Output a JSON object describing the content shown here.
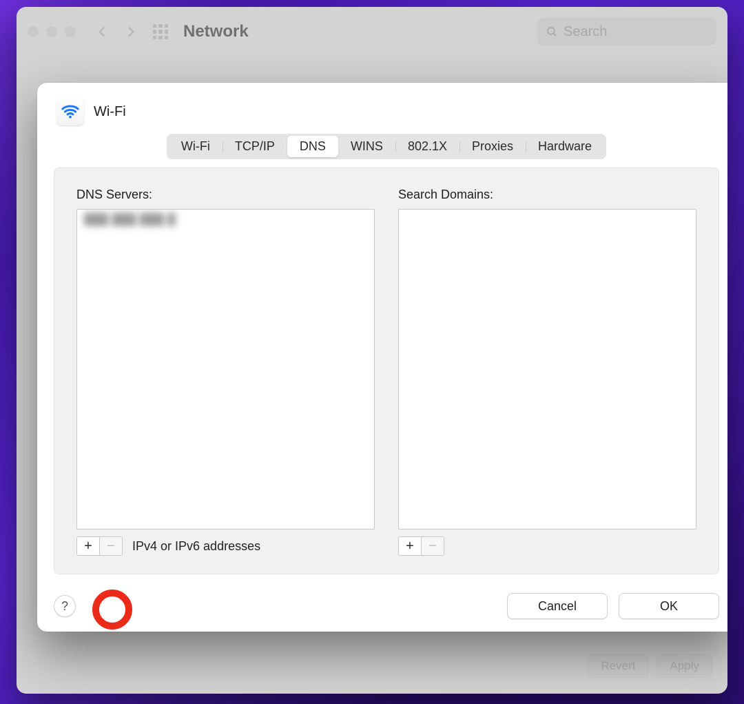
{
  "toolbar": {
    "title": "Network",
    "search_placeholder": "Search"
  },
  "background_footer": {
    "revert_label": "Revert",
    "apply_label": "Apply"
  },
  "modal": {
    "title": "Wi-Fi",
    "tabs": [
      {
        "label": "Wi-Fi",
        "active": false
      },
      {
        "label": "TCP/IP",
        "active": false
      },
      {
        "label": "DNS",
        "active": true
      },
      {
        "label": "WINS",
        "active": false
      },
      {
        "label": "802.1X",
        "active": false
      },
      {
        "label": "Proxies",
        "active": false
      },
      {
        "label": "Hardware",
        "active": false
      }
    ],
    "dns": {
      "servers_label": "DNS Servers:",
      "servers": [
        "███ ███ ███ █"
      ],
      "hint": "IPv4 or IPv6 addresses",
      "domains_label": "Search Domains:",
      "domains": []
    },
    "help_label": "?",
    "cancel_label": "Cancel",
    "ok_label": "OK"
  },
  "icons": {
    "plus": "+",
    "minus": "−"
  },
  "colors": {
    "highlight": "#ec2a1a",
    "wifi_blue": "#1f79ff"
  }
}
